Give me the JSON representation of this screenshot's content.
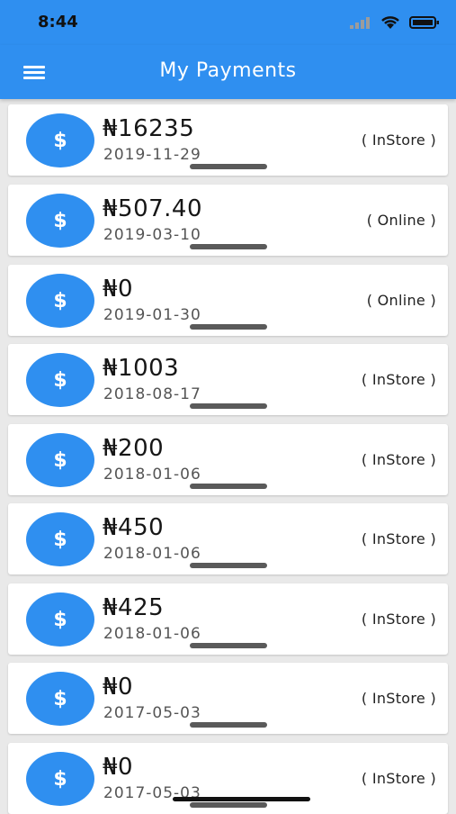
{
  "status": {
    "time": "8:44",
    "icons": [
      "signal-icon",
      "wifi-icon",
      "battery-icon"
    ]
  },
  "appbar": {
    "title": "My Payments",
    "menu_icon": "hamburger-menu-icon"
  },
  "colors": {
    "primary": "#2f8ff0",
    "background": "#e9e9e9",
    "card": "#ffffff"
  },
  "payments": [
    {
      "icon": "$",
      "amount": "₦16235",
      "date": "2019-11-29",
      "channel": "( InStore )"
    },
    {
      "icon": "$",
      "amount": "₦507.40",
      "date": "2019-03-10",
      "channel": "( Online )"
    },
    {
      "icon": "$",
      "amount": "₦0",
      "date": "2019-01-30",
      "channel": "( Online )"
    },
    {
      "icon": "$",
      "amount": "₦1003",
      "date": "2018-08-17",
      "channel": "( InStore )"
    },
    {
      "icon": "$",
      "amount": "₦200",
      "date": "2018-01-06",
      "channel": "( InStore )"
    },
    {
      "icon": "$",
      "amount": "₦450",
      "date": "2018-01-06",
      "channel": "( InStore )"
    },
    {
      "icon": "$",
      "amount": "₦425",
      "date": "2018-01-06",
      "channel": "( InStore )"
    },
    {
      "icon": "$",
      "amount": "₦0",
      "date": "2017-05-03",
      "channel": "( InStore )"
    },
    {
      "icon": "$",
      "amount": "₦0",
      "date": "2017-05-03",
      "channel": "( InStore )"
    }
  ]
}
